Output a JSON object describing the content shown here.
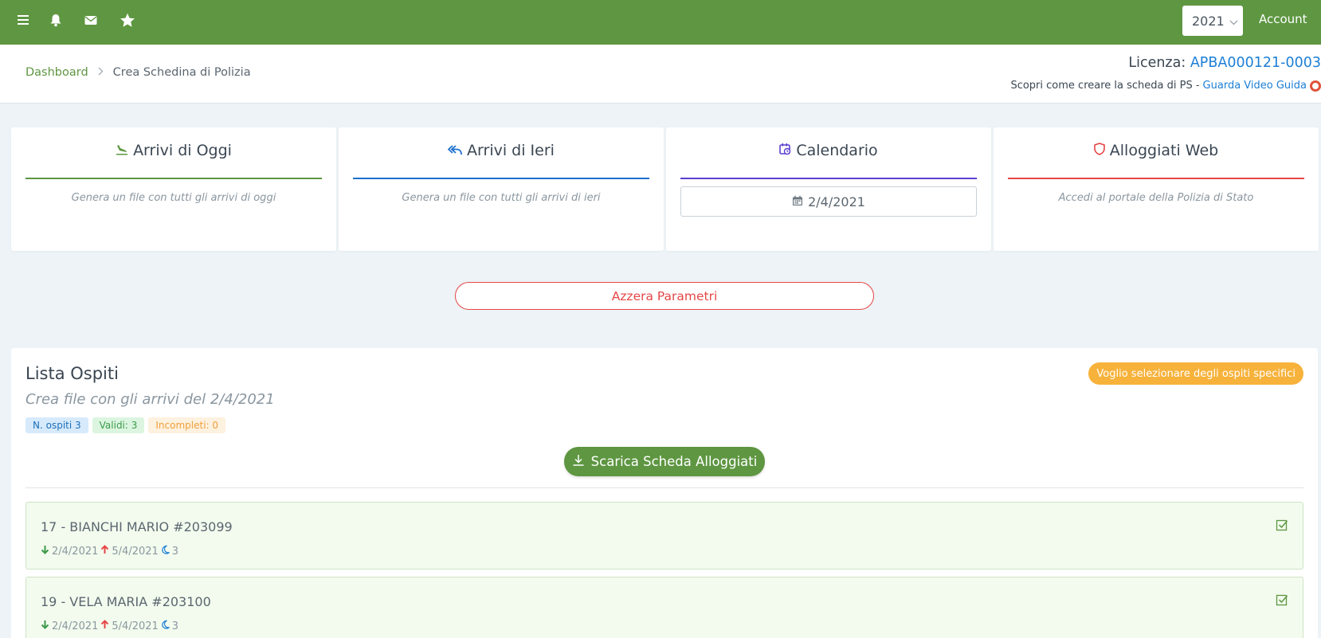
{
  "topbar": {
    "icons": [
      "menu-icon",
      "bell-icon",
      "mail-icon",
      "star-icon"
    ],
    "year": "2021",
    "account_label": "Account",
    "color": "#5e9641"
  },
  "breadcrumb": {
    "home": "Dashboard",
    "current": "Crea Schedina di Polizia"
  },
  "license": {
    "label": "Licenza:",
    "code": "APBA000121-0003"
  },
  "guide": {
    "text": "Scopri come creare la scheda di PS -",
    "link": "Guarda Video Guida"
  },
  "cards": [
    {
      "title": "Arrivi di Oggi",
      "description": "Genera un file con tutti gli arrivi di oggi",
      "accent": "#5e9641",
      "icon": "plane-landing-icon"
    },
    {
      "title": "Arrivi di Ieri",
      "description": "Genera un file con tutti gli arrivi di ieri",
      "accent": "#1c6fcf",
      "icon": "reply-all-icon"
    },
    {
      "title": "Calendario",
      "date_value": "2/4/2021",
      "accent": "#5b3fd0",
      "icon": "calendar-clock-icon"
    },
    {
      "title": "Alloggiati Web",
      "description": "Accedi al portale della Polizia di Stato",
      "accent": "#e64646",
      "icon": "shield-icon"
    }
  ],
  "reset_button": "Azzera Parametri",
  "guest_list": {
    "title": "Lista Ospiti",
    "subtitle": "Crea file con gli arrivi del 2/4/2021",
    "select_button": "Voglio selezionare degli ospiti specifici",
    "badges": {
      "total": "N. ospiti 3",
      "valid": "Validi: 3",
      "incomplete": "Incompleti: 0"
    },
    "download_button": "Scarica Scheda Alloggiati",
    "guests": [
      {
        "name": "17 - BIANCHI MARIO #203099",
        "arrival": "2/4/2021",
        "departure": "5/4/2021",
        "nights": "3"
      },
      {
        "name": "19 - VELA MARIA #203100",
        "arrival": "2/4/2021",
        "departure": "5/4/2021",
        "nights": "3"
      }
    ]
  }
}
